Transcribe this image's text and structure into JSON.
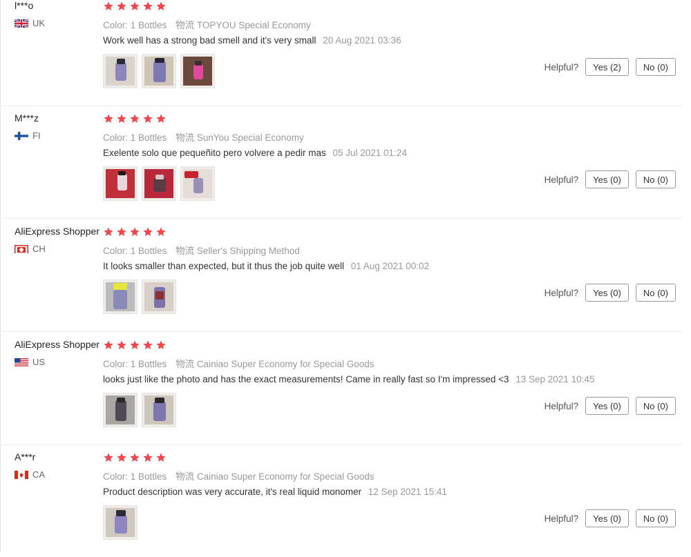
{
  "reviews": [
    {
      "user": "l***o",
      "country": "UK",
      "flag": "uk-flag-icon",
      "rating": 5,
      "color_label": "Color:",
      "color_value": "1 Bottles",
      "logistics_label": "物流",
      "logistics_value": "TOPYOU Special Economy",
      "text": "Work well has a strong bad smell and it's very small",
      "date": "20 Aug 2021 03:36",
      "photos": 3,
      "helpful_label": "Helpful?",
      "yes_label": "Yes (2)",
      "no_label": "No (0)"
    },
    {
      "user": "M***z",
      "country": "FI",
      "flag": "finland-flag-icon",
      "rating": 5,
      "color_label": "Color:",
      "color_value": "1 Bottles",
      "logistics_label": "物流",
      "logistics_value": "SunYou Special Economy",
      "text": "Exelente solo que pequeñito pero volvere a pedir mas",
      "date": "05 Jul 2021 01:24",
      "photos": 3,
      "helpful_label": "Helpful?",
      "yes_label": "Yes (0)",
      "no_label": "No (0)"
    },
    {
      "user": "AliExpress Shopper",
      "country": "CH",
      "flag": "switzerland-flag-icon",
      "rating": 5,
      "color_label": "Color:",
      "color_value": "1 Bottles",
      "logistics_label": "物流",
      "logistics_value": "Seller's Shipping Method",
      "text": "It looks smaller than expected, but it thus the job quite well",
      "date": "01 Aug 2021 00:02",
      "photos": 2,
      "helpful_label": "Helpful?",
      "yes_label": "Yes (0)",
      "no_label": "No (0)"
    },
    {
      "user": "AliExpress Shopper",
      "country": "US",
      "flag": "us-flag-icon",
      "rating": 5,
      "color_label": "Color:",
      "color_value": "1 Bottles",
      "logistics_label": "物流",
      "logistics_value": "Cainiao Super Economy for Special Goods",
      "text": "looks just like the photo and has the exact measurements! Came in really fast so I'm impressed <3",
      "date": "13 Sep 2021 10:45",
      "photos": 2,
      "helpful_label": "Helpful?",
      "yes_label": "Yes (0)",
      "no_label": "No (0)"
    },
    {
      "user": "A***r",
      "country": "CA",
      "flag": "canada-flag-icon",
      "rating": 5,
      "color_label": "Color:",
      "color_value": "1 Bottles",
      "logistics_label": "物流",
      "logistics_value": "Cainiao Super Economy for Special Goods",
      "text": "Product description was very accurate, it's real liquid monomer",
      "date": "12 Sep 2021 15:41",
      "photos": 1,
      "helpful_label": "Helpful?",
      "yes_label": "Yes (0)",
      "no_label": "No (0)"
    }
  ],
  "colors": {
    "star": "#f0474e",
    "muted_text": "#999999",
    "body_text": "#333333",
    "divider": "#ececec"
  }
}
